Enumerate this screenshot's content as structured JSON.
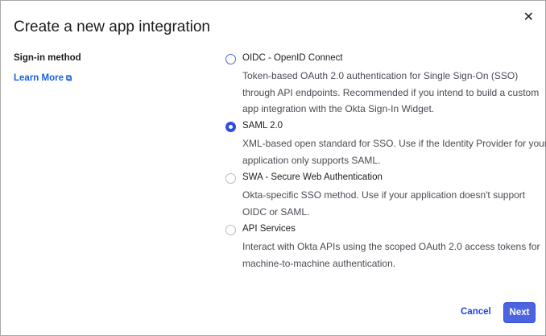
{
  "dialog": {
    "title": "Create a new app integration",
    "close_icon": "close-icon"
  },
  "left": {
    "label": "Sign-in method",
    "learn_more": "Learn More",
    "learn_more_icon": "external-link-icon"
  },
  "options": [
    {
      "title": "OIDC - OpenID Connect",
      "description": "Token-based OAuth 2.0 authentication for Single Sign-On (SSO) through API endpoints. Recommended if you intend to build a custom app integration with the Okta Sign-In Widget.",
      "selected": false
    },
    {
      "title": "SAML 2.0",
      "description": "XML-based open standard for SSO. Use if the Identity Provider for your application only supports SAML.",
      "selected": true
    },
    {
      "title": "SWA - Secure Web Authentication",
      "description": "Okta-specific SSO method. Use if your application doesn't support OIDC or SAML.",
      "selected": false
    },
    {
      "title": "API Services",
      "description": "Interact with Okta APIs using the scoped OAuth 2.0 access tokens for machine-to-machine authentication.",
      "selected": false
    }
  ],
  "footer": {
    "cancel": "Cancel",
    "next": "Next"
  },
  "colors": {
    "accent": "#4c64e0",
    "link": "#1662dd"
  }
}
